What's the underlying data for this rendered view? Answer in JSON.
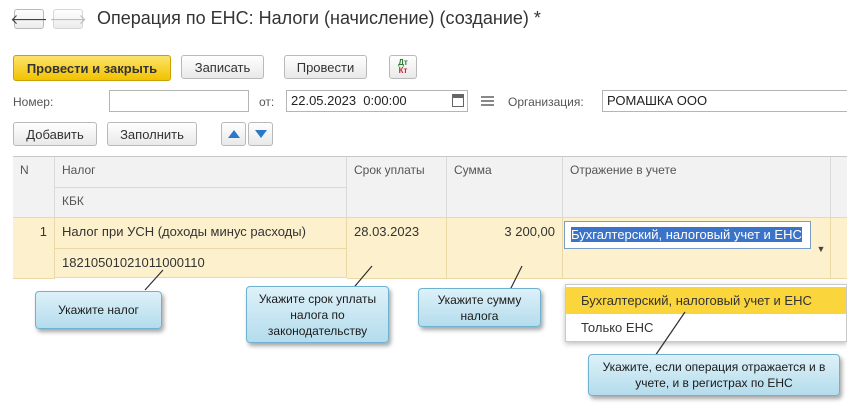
{
  "header": {
    "back_icon": "arrow-left-icon",
    "forward_icon": "arrow-right-icon",
    "title": "Операция по ЕНС: Налоги (начисление) (создание) *"
  },
  "toolbar": {
    "post_close_label": "Провести и закрыть",
    "save_label": "Записать",
    "post_label": "Провести",
    "dt_kt_dt": "Дт",
    "dt_kt_kt": "Кт"
  },
  "form": {
    "number_label": "Номер:",
    "number_value": "",
    "date_label": "от:",
    "date_value": "22.05.2023  0:00:00",
    "org_label": "Организация:",
    "org_value": "РОМАШКА ООО"
  },
  "table_toolbar": {
    "add_label": "Добавить",
    "fill_label": "Заполнить"
  },
  "table": {
    "columns": {
      "n": "N",
      "tax": "Налог",
      "kbk": "КБК",
      "due": "Срок уплаты",
      "sum": "Сумма",
      "reflection": "Отражение в учете"
    },
    "rows": [
      {
        "n": "1",
        "tax": "Налог при УСН (доходы минус расходы)",
        "kbk": "18210501021011000110",
        "due": "28.03.2023",
        "sum": "3 200,00",
        "reflection": "Бухгалтерский, налоговый учет и ЕНС"
      }
    ]
  },
  "dropdown": {
    "options": [
      "Бухгалтерский, налоговый учет и ЕНС",
      "Только ЕНС"
    ],
    "selected_index": 0
  },
  "callouts": {
    "tax": "Укажите налог",
    "due": "Укажите срок уплаты налога по законодательству",
    "sum": "Укажите сумму налога",
    "reflection": "Укажите, если операция отражается и в учете, и в регистрах по ЕНС"
  },
  "colors": {
    "primary_button": "#f2c200",
    "selected_row": "#fdf1cd",
    "callout": "#b4dcec",
    "dropdown_selected": "#fad53c"
  }
}
